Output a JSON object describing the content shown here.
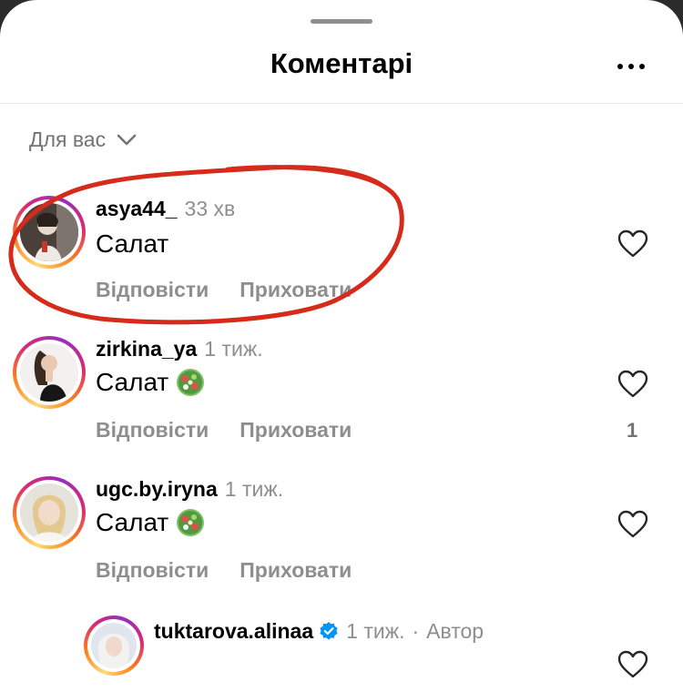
{
  "header": {
    "title": "Коментарі",
    "more_icon": "more-horizontal-icon"
  },
  "sort": {
    "label": "Для вас",
    "icon": "chevron-down-icon"
  },
  "comments": [
    {
      "username": "asya44_",
      "time": "33 хв",
      "text": "Салат",
      "has_emoji": false,
      "reply_label": "Відповісти",
      "hide_label": "Приховати",
      "likes": ""
    },
    {
      "username": "zirkina_ya",
      "time": "1 тиж.",
      "text": "Салат",
      "has_emoji": true,
      "emoji_icon": "green-salad-icon",
      "reply_label": "Відповісти",
      "hide_label": "Приховати",
      "likes": "1"
    },
    {
      "username": "ugc.by.iryna",
      "time": "1 тиж.",
      "text": "Салат",
      "has_emoji": true,
      "emoji_icon": "green-salad-icon",
      "reply_label": "Відповісти",
      "hide_label": "Приховати",
      "likes": ""
    }
  ],
  "reply": {
    "username": "tuktarova.alinaa",
    "verified_icon": "verified-badge-icon",
    "time": "1 тиж.",
    "separator": "·",
    "author_label": "Автор"
  },
  "colors": {
    "annotation_stroke": "#d62a1a",
    "verified": "#0095f6",
    "secondary_text": "#8e8e8e"
  }
}
